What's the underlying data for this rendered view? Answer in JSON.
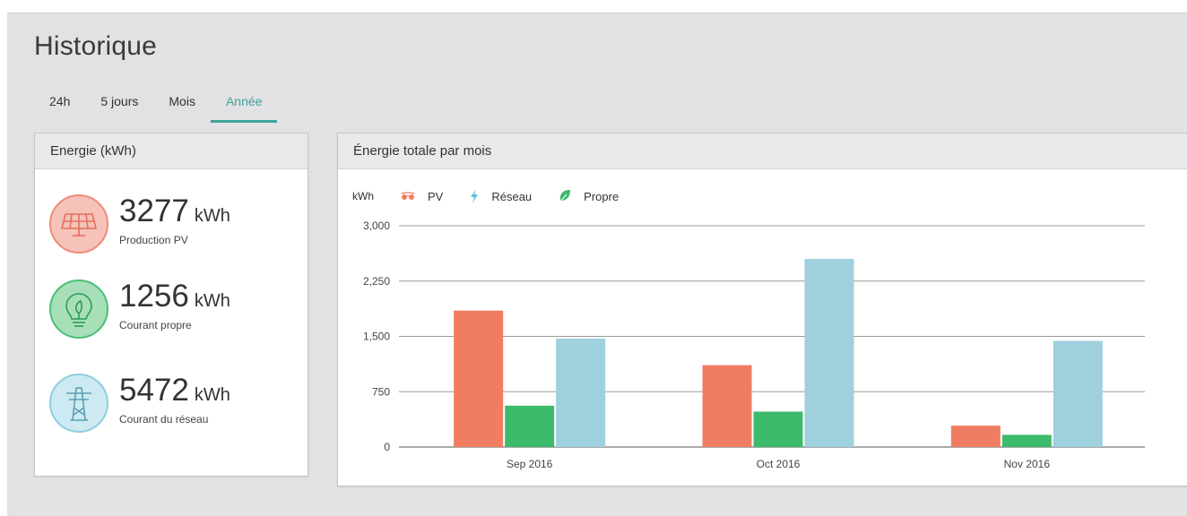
{
  "page": {
    "title": "Historique",
    "tabs": [
      {
        "label": "24h",
        "active": false
      },
      {
        "label": "5 jours",
        "active": false
      },
      {
        "label": "Mois",
        "active": false
      },
      {
        "label": "Année",
        "active": true
      }
    ]
  },
  "energy": {
    "title": "Energie (kWh)",
    "stats": [
      {
        "value": "3277",
        "unit": "kWh",
        "label": "Production PV",
        "icon": "solar-panel-icon",
        "color": "#f28b7a",
        "bg": "#f6c3ba"
      },
      {
        "value": "1256",
        "unit": "kWh",
        "label": "Courant propre",
        "icon": "lightbulb-leaf-icon",
        "color": "#4cbf77",
        "bg": "#a7dfb8"
      },
      {
        "value": "5472",
        "unit": "kWh",
        "label": "Courant du réseau",
        "icon": "power-pylon-icon",
        "color": "#8fcede",
        "bg": "#cdeaf2"
      }
    ]
  },
  "chart": {
    "title": "Énergie totale par mois",
    "legend": [
      {
        "label": "PV",
        "icon": "sunglasses-icon",
        "color": "#f07d62"
      },
      {
        "label": "Réseau",
        "icon": "lightning-icon",
        "color": "#5cc2e0"
      },
      {
        "label": "Propre",
        "icon": "leaf-icon",
        "color": "#3dbb6c"
      }
    ]
  },
  "chart_data": {
    "type": "bar",
    "ylabel": "kWh",
    "categories": [
      "Sep 2016",
      "Oct 2016",
      "Nov 2016"
    ],
    "ylim": [
      0,
      3000
    ],
    "yticks": [
      "0",
      "750",
      "1,500",
      "2,250",
      "3,000"
    ],
    "ytick_values": [
      0,
      750,
      1500,
      2250,
      3000
    ],
    "grid": true,
    "legend_position": "top-left",
    "series": [
      {
        "name": "PV",
        "color": "#f07d62",
        "values": [
          1850,
          1110,
          290
        ]
      },
      {
        "name": "Propre",
        "color": "#3dbb6c",
        "values": [
          560,
          480,
          165
        ]
      },
      {
        "name": "Réseau",
        "color": "#9fd0dd",
        "values": [
          1470,
          2550,
          1440
        ]
      }
    ]
  }
}
